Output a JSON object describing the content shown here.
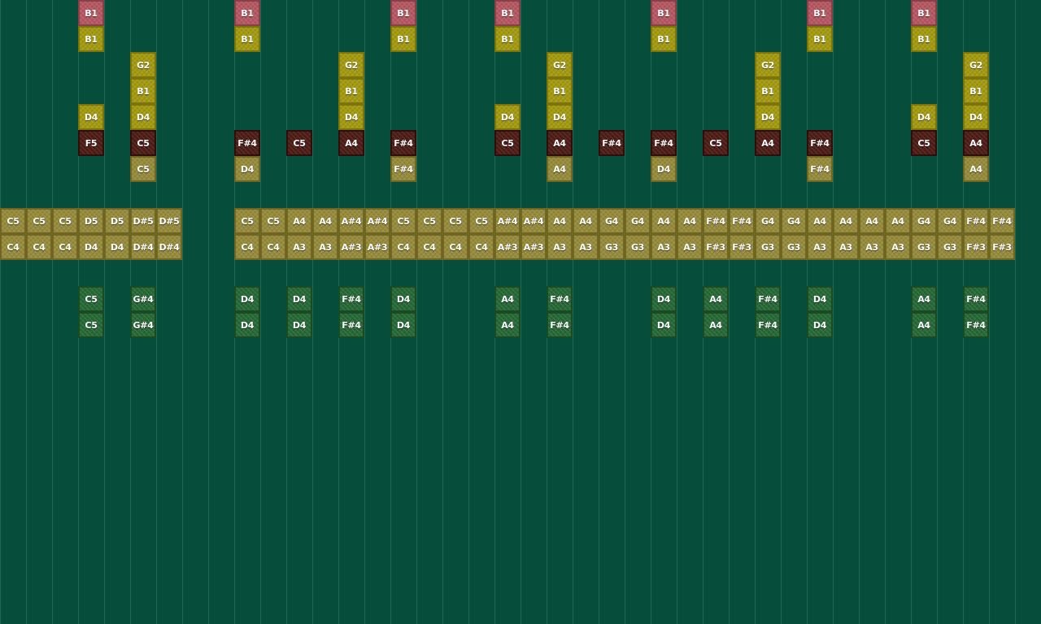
{
  "colors": {
    "background": "#064d3c",
    "pink": "#b65862",
    "olive": "#a39a12",
    "brown": "#4d1d16",
    "khaki": "#968b3c",
    "green": "#276936"
  },
  "rows": [
    {
      "color": "pink",
      "cells": [
        [
          3,
          "B1"
        ],
        [
          9,
          "B1"
        ],
        [
          15,
          "B1"
        ],
        [
          19,
          "B1"
        ],
        [
          25,
          "B1"
        ],
        [
          31,
          "B1"
        ],
        [
          35,
          "B1"
        ]
      ]
    },
    {
      "color": "olive",
      "cells": [
        [
          3,
          "B1"
        ],
        [
          9,
          "B1"
        ],
        [
          15,
          "B1"
        ],
        [
          19,
          "B1"
        ],
        [
          25,
          "B1"
        ],
        [
          31,
          "B1"
        ],
        [
          35,
          "B1"
        ]
      ]
    },
    {
      "color": "olive",
      "cells": [
        [
          5,
          "G2"
        ],
        [
          13,
          "G2"
        ],
        [
          21,
          "G2"
        ],
        [
          29,
          "G2"
        ],
        [
          37,
          "G2"
        ]
      ]
    },
    {
      "color": "olive",
      "cells": [
        [
          5,
          "B1"
        ],
        [
          13,
          "B1"
        ],
        [
          21,
          "B1"
        ],
        [
          29,
          "B1"
        ],
        [
          37,
          "B1"
        ]
      ]
    },
    {
      "color": "olive",
      "cells": [
        [
          3,
          "D4"
        ],
        [
          5,
          "D4"
        ],
        [
          13,
          "D4"
        ],
        [
          19,
          "D4"
        ],
        [
          21,
          "D4"
        ],
        [
          29,
          "D4"
        ],
        [
          35,
          "D4"
        ],
        [
          37,
          "D4"
        ]
      ]
    },
    {
      "color": "brown",
      "cells": [
        [
          3,
          "F5"
        ],
        [
          5,
          "C5"
        ],
        [
          9,
          "F#4"
        ],
        [
          11,
          "C5"
        ],
        [
          13,
          "A4"
        ],
        [
          15,
          "F#4"
        ],
        [
          19,
          "C5"
        ],
        [
          21,
          "A4"
        ],
        [
          23,
          "F#4"
        ],
        [
          25,
          "F#4"
        ],
        [
          27,
          "C5"
        ],
        [
          29,
          "A4"
        ],
        [
          31,
          "F#4"
        ],
        [
          35,
          "C5"
        ],
        [
          37,
          "A4"
        ]
      ]
    },
    {
      "color": "khaki",
      "cells": [
        [
          5,
          "C5"
        ],
        [
          9,
          "D4"
        ],
        [
          15,
          "F#4"
        ],
        [
          21,
          "A4"
        ],
        [
          25,
          "D4"
        ],
        [
          31,
          "F#4"
        ],
        [
          37,
          "A4"
        ]
      ]
    },
    {
      "color": "khaki",
      "cells": []
    },
    {
      "color": "khaki",
      "cells": [
        [
          0,
          "C5"
        ],
        [
          1,
          "C5"
        ],
        [
          2,
          "C5"
        ],
        [
          3,
          "D5"
        ],
        [
          4,
          "D5"
        ],
        [
          5,
          "D#5"
        ],
        [
          6,
          "D#5"
        ],
        [
          9,
          "C5"
        ],
        [
          10,
          "C5"
        ],
        [
          11,
          "A4"
        ],
        [
          12,
          "A4"
        ],
        [
          13,
          "A#4"
        ],
        [
          14,
          "A#4"
        ],
        [
          15,
          "C5"
        ],
        [
          16,
          "C5"
        ],
        [
          17,
          "C5"
        ],
        [
          18,
          "C5"
        ],
        [
          19,
          "A#4"
        ],
        [
          20,
          "A#4"
        ],
        [
          21,
          "A4"
        ],
        [
          22,
          "A4"
        ],
        [
          23,
          "G4"
        ],
        [
          24,
          "G4"
        ],
        [
          25,
          "A4"
        ],
        [
          26,
          "A4"
        ],
        [
          27,
          "F#4"
        ],
        [
          28,
          "F#4"
        ],
        [
          29,
          "G4"
        ],
        [
          30,
          "G4"
        ],
        [
          31,
          "A4"
        ],
        [
          32,
          "A4"
        ],
        [
          33,
          "A4"
        ],
        [
          34,
          "A4"
        ],
        [
          35,
          "G4"
        ],
        [
          36,
          "G4"
        ],
        [
          37,
          "F#4"
        ],
        [
          38,
          "F#4"
        ]
      ]
    },
    {
      "color": "khaki",
      "cells": [
        [
          0,
          "C4"
        ],
        [
          1,
          "C4"
        ],
        [
          2,
          "C4"
        ],
        [
          3,
          "D4"
        ],
        [
          4,
          "D4"
        ],
        [
          5,
          "D#4"
        ],
        [
          6,
          "D#4"
        ],
        [
          9,
          "C4"
        ],
        [
          10,
          "C4"
        ],
        [
          11,
          "A3"
        ],
        [
          12,
          "A3"
        ],
        [
          13,
          "A#3"
        ],
        [
          14,
          "A#3"
        ],
        [
          15,
          "C4"
        ],
        [
          16,
          "C4"
        ],
        [
          17,
          "C4"
        ],
        [
          18,
          "C4"
        ],
        [
          19,
          "A#3"
        ],
        [
          20,
          "A#3"
        ],
        [
          21,
          "A3"
        ],
        [
          22,
          "A3"
        ],
        [
          23,
          "G3"
        ],
        [
          24,
          "G3"
        ],
        [
          25,
          "A3"
        ],
        [
          26,
          "A3"
        ],
        [
          27,
          "F#3"
        ],
        [
          28,
          "F#3"
        ],
        [
          29,
          "G3"
        ],
        [
          30,
          "G3"
        ],
        [
          31,
          "A3"
        ],
        [
          32,
          "A3"
        ],
        [
          33,
          "A3"
        ],
        [
          34,
          "A3"
        ],
        [
          35,
          "G3"
        ],
        [
          36,
          "G3"
        ],
        [
          37,
          "F#3"
        ],
        [
          38,
          "F#3"
        ]
      ]
    },
    {
      "color": "green",
      "cells": []
    },
    {
      "color": "green",
      "cells": [
        [
          3,
          "C5"
        ],
        [
          5,
          "G#4"
        ],
        [
          9,
          "D4"
        ],
        [
          11,
          "D4"
        ],
        [
          13,
          "F#4"
        ],
        [
          15,
          "D4"
        ],
        [
          19,
          "A4"
        ],
        [
          21,
          "F#4"
        ],
        [
          25,
          "D4"
        ],
        [
          27,
          "A4"
        ],
        [
          29,
          "F#4"
        ],
        [
          31,
          "D4"
        ],
        [
          35,
          "A4"
        ],
        [
          37,
          "F#4"
        ]
      ]
    },
    {
      "color": "green",
      "cells": [
        [
          3,
          "C5"
        ],
        [
          5,
          "G#4"
        ],
        [
          9,
          "D4"
        ],
        [
          11,
          "D4"
        ],
        [
          13,
          "F#4"
        ],
        [
          15,
          "D4"
        ],
        [
          19,
          "A4"
        ],
        [
          21,
          "F#4"
        ],
        [
          25,
          "D4"
        ],
        [
          27,
          "A4"
        ],
        [
          29,
          "F#4"
        ],
        [
          31,
          "D4"
        ],
        [
          35,
          "A4"
        ],
        [
          37,
          "F#4"
        ]
      ]
    }
  ]
}
